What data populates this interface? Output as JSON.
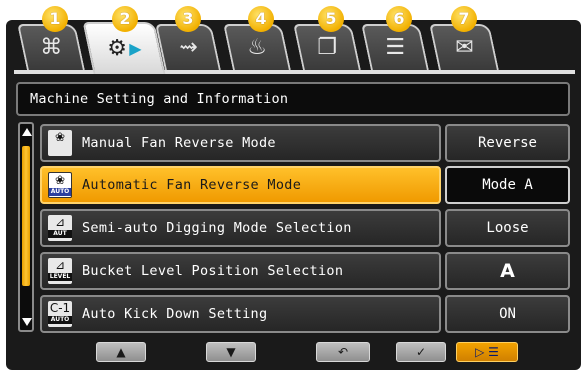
{
  "tabs": [
    {
      "number": "1",
      "icon": "leaf-icon",
      "glyph": "⌘"
    },
    {
      "number": "2",
      "icon": "machine-settings-icon",
      "glyph": "⚙"
    },
    {
      "number": "3",
      "icon": "signal-icon",
      "glyph": "⇝"
    },
    {
      "number": "4",
      "icon": "operator-icon",
      "glyph": "♨"
    },
    {
      "number": "5",
      "icon": "manual-book-icon",
      "glyph": "❐"
    },
    {
      "number": "6",
      "icon": "list-icon",
      "glyph": "☰"
    },
    {
      "number": "7",
      "icon": "mail-icon",
      "glyph": "✉"
    }
  ],
  "active_tab_index": 1,
  "title": "Machine Setting and Information",
  "rows": [
    {
      "label": "Manual Fan Reverse Mode",
      "value": "Reverse",
      "icon": "fan-icon",
      "icon_sub": "",
      "selected": false
    },
    {
      "label": "Automatic Fan Reverse Mode",
      "value": "Mode A",
      "icon": "auto-fan-icon",
      "icon_sub": "AUTO",
      "selected": true
    },
    {
      "label": "Semi-auto Digging Mode Selection",
      "value": "Loose",
      "icon": "digging-icon",
      "icon_sub": "AUT",
      "selected": false
    },
    {
      "label": "Bucket Level Position Selection",
      "value": "A",
      "icon": "bucket-level-icon",
      "icon_sub": "LEVEL",
      "selected": false
    },
    {
      "label": "Auto Kick Down Setting",
      "value": "ON",
      "icon": "kick-down-icon",
      "icon_sub": "AUTO",
      "selected": false
    }
  ],
  "buttons": [
    {
      "name": "scroll-up-button",
      "glyph": "▲",
      "primary": false
    },
    {
      "name": "scroll-down-button",
      "glyph": "▼",
      "primary": false
    },
    {
      "name": "back-button",
      "glyph": "↶",
      "primary": false
    },
    {
      "name": "confirm-button",
      "glyph": "✓",
      "primary": false
    },
    {
      "name": "next-page-button",
      "glyph": "▷ ☰",
      "primary": true
    }
  ],
  "colors": {
    "accent": "#f5a800",
    "background": "#1a1a1a",
    "badge": "#f2b000"
  }
}
